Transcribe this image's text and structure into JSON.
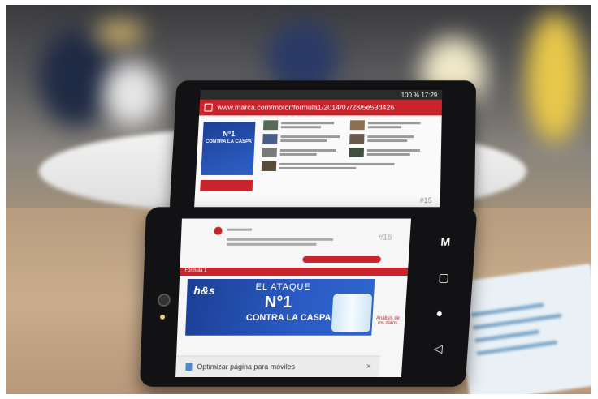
{
  "scene": {
    "subject": "dual-screen folding smartphone",
    "background_colors": [
      "#3a3b3e",
      "#c6a886"
    ],
    "accent_color": "#c9242b"
  },
  "top_screen": {
    "status_time": "100 % 17:29",
    "url": "www.marca.com/motor/formula1/2014/07/28/5e53d426",
    "page_number": "#15",
    "ad_title": "N°1",
    "ad_subtitle": "CONTRA LA CASPA"
  },
  "bottom_screen": {
    "page_number": "#15",
    "band_label": "Fórmula 1",
    "ad_line1": "EL ATAQUE",
    "ad_line2": "N°1",
    "ad_line3": "CONTRA LA CASPA",
    "brand": "h&s",
    "side_caption": "Análisis de los datos",
    "snackbar_text": "Optimizar página para móviles",
    "snackbar_close": "×",
    "nav_keys": [
      "M",
      "▢",
      "●",
      "◁"
    ]
  }
}
